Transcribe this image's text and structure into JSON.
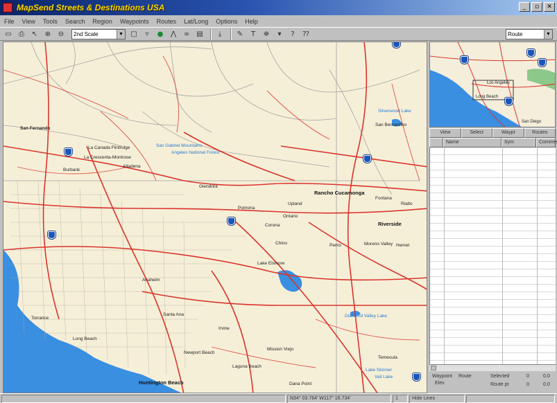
{
  "window": {
    "title": "MapSend Streets & Destinations USA",
    "buttons": [
      "_",
      "▫",
      "✕"
    ]
  },
  "menu": [
    "File",
    "View",
    "Tools",
    "Search",
    "Region",
    "Waypoints",
    "Routes",
    "Lat/Long",
    "Options",
    "Help"
  ],
  "toolbar": {
    "scale_value": "2nd Scale",
    "mode_value": "Route"
  },
  "map": {
    "labels": [
      {
        "text": "San Fernando",
        "cls": "bold"
      },
      {
        "text": "La Canada Flintridge",
        "cls": ""
      },
      {
        "text": "La Crescenta-Montrose",
        "cls": ""
      },
      {
        "text": "Burbank",
        "cls": ""
      },
      {
        "text": "Altadena",
        "cls": ""
      },
      {
        "text": "San Gabriel Mountains",
        "cls": ""
      },
      {
        "text": "Angeles National Forest",
        "cls": "water"
      },
      {
        "text": "Glendora",
        "cls": ""
      },
      {
        "text": "Rancho Cucamonga",
        "cls": "bold"
      },
      {
        "text": "Fontana",
        "cls": ""
      },
      {
        "text": "Rialto",
        "cls": ""
      },
      {
        "text": "Upland",
        "cls": ""
      },
      {
        "text": "Ontario",
        "cls": ""
      },
      {
        "text": "Pomona",
        "cls": ""
      },
      {
        "text": "Chino",
        "cls": ""
      },
      {
        "text": "Riverside",
        "cls": "bold"
      },
      {
        "text": "Corona",
        "cls": ""
      },
      {
        "text": "Moreno Valley",
        "cls": ""
      },
      {
        "text": "Perris",
        "cls": ""
      },
      {
        "text": "Lake Elsinore",
        "cls": ""
      },
      {
        "text": "Hemet",
        "cls": ""
      },
      {
        "text": "Diamond Valley Lake",
        "cls": "water"
      },
      {
        "text": "Silverwood Lake",
        "cls": "water"
      },
      {
        "text": "San Bernardino",
        "cls": ""
      },
      {
        "text": "Anaheim",
        "cls": ""
      },
      {
        "text": "Santa Ana",
        "cls": ""
      },
      {
        "text": "Irvine",
        "cls": ""
      },
      {
        "text": "Torrance",
        "cls": ""
      },
      {
        "text": "Long Beach",
        "cls": ""
      },
      {
        "text": "Huntington Beach",
        "cls": "bold"
      },
      {
        "text": "Newport Beach",
        "cls": ""
      },
      {
        "text": "Laguna Beach",
        "cls": ""
      },
      {
        "text": "Dana Point",
        "cls": ""
      },
      {
        "text": "Mission Viejo",
        "cls": ""
      },
      {
        "text": "Temecula",
        "cls": ""
      },
      {
        "text": "Lake Skinner",
        "cls": "water"
      },
      {
        "text": "Vail Lake",
        "cls": "water"
      }
    ]
  },
  "overview": {
    "labels": [
      "Los Angeles",
      "Long Beach",
      "San Diego"
    ]
  },
  "panel": {
    "tabs": [
      "View",
      "Select",
      "Waypt",
      "Routes"
    ],
    "columns": [
      "",
      "Name",
      "Sym",
      "Comment"
    ],
    "info": {
      "r1c1": "Waypoint",
      "r1c2": "Route",
      "r2c1": "Elev",
      "r1c3": "Selected",
      "r1c4": "0",
      "r2c3": "Route pt",
      "r2c4": "0",
      "r1c5": "0.0",
      "r2c5": "0.0"
    }
  },
  "status": {
    "coords": "N34° 03.764' W117° 16.734'",
    "zoom": "1",
    "mode": "Hide Lines"
  },
  "colors": {
    "map_bg": "#f6efd8",
    "major_road": "#d9342b",
    "minor_road": "#9a9a9a",
    "water": "#3a8fe0",
    "interstate": "#1a56b8",
    "title_text": "#f5d800"
  }
}
